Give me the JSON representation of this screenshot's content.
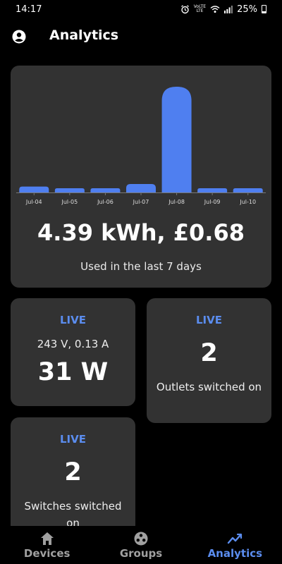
{
  "status_bar": {
    "time": "14:17",
    "battery": "25%",
    "lte_top": "VoLTE",
    "lte_label": "LTE"
  },
  "header": {
    "title": "Analytics",
    "profile_icon": "account-circle-icon"
  },
  "usage_card": {
    "total": "4.39 kWh, £0.68",
    "subtitle": "Used in the last 7 days"
  },
  "chart_data": {
    "type": "bar",
    "categories": [
      "Jul-04",
      "Jul-05",
      "Jul-06",
      "Jul-07",
      "Jul-08",
      "Jul-09",
      "Jul-10"
    ],
    "values": [
      0.14,
      0.07,
      0.07,
      0.2,
      2.49,
      0.07,
      0.09
    ],
    "bar_color": "#4f7ff0",
    "grid": false
  },
  "power_card": {
    "live": "LIVE",
    "voltage_current": "243 V, 0.13 A",
    "power": "31 W"
  },
  "outlets_card": {
    "live": "LIVE",
    "count": "2",
    "label": "Outlets switched on"
  },
  "switches_card": {
    "live": "LIVE",
    "count": "2",
    "label": "Switches switched on"
  },
  "nav": {
    "items": [
      {
        "label": "Devices",
        "icon": "home-icon",
        "active": false
      },
      {
        "label": "Groups",
        "icon": "groups-icon",
        "active": false
      },
      {
        "label": "Analytics",
        "icon": "trend-icon",
        "active": true
      }
    ]
  },
  "colors": {
    "accent": "#5b8def",
    "card": "#323232",
    "background": "#000000"
  }
}
